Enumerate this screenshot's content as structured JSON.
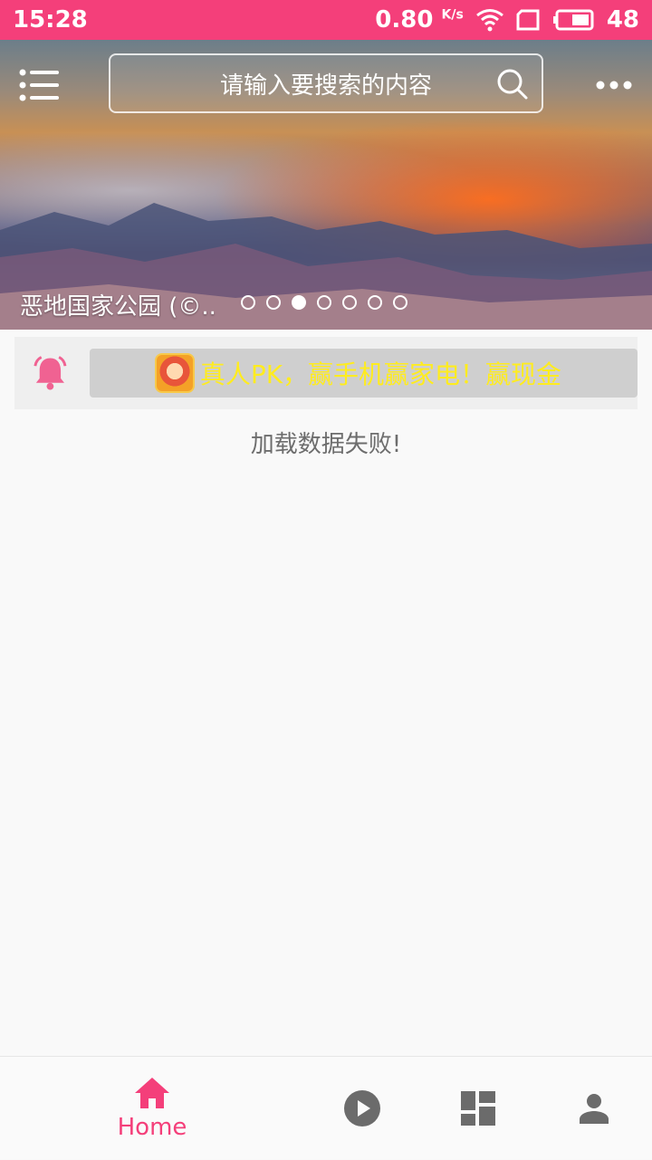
{
  "status_bar": {
    "time": "15:28",
    "speed": "0.80",
    "speed_unit": "K/s",
    "battery": "48"
  },
  "topbar": {
    "search_placeholder": "请输入要搜索的内容"
  },
  "banner": {
    "caption": "恶地国家公园 (©..",
    "slide_count": 7,
    "active_slide": 3
  },
  "notice": {
    "text": "真人PK，赢手机赢家电！赢现金"
  },
  "content": {
    "error": "加载数据失败!"
  },
  "tabbar": {
    "home_label": "Home"
  },
  "colors": {
    "accent": "#f43f7a",
    "notice_text": "#ffec1f",
    "inactive_icon": "#6b6b6b"
  }
}
